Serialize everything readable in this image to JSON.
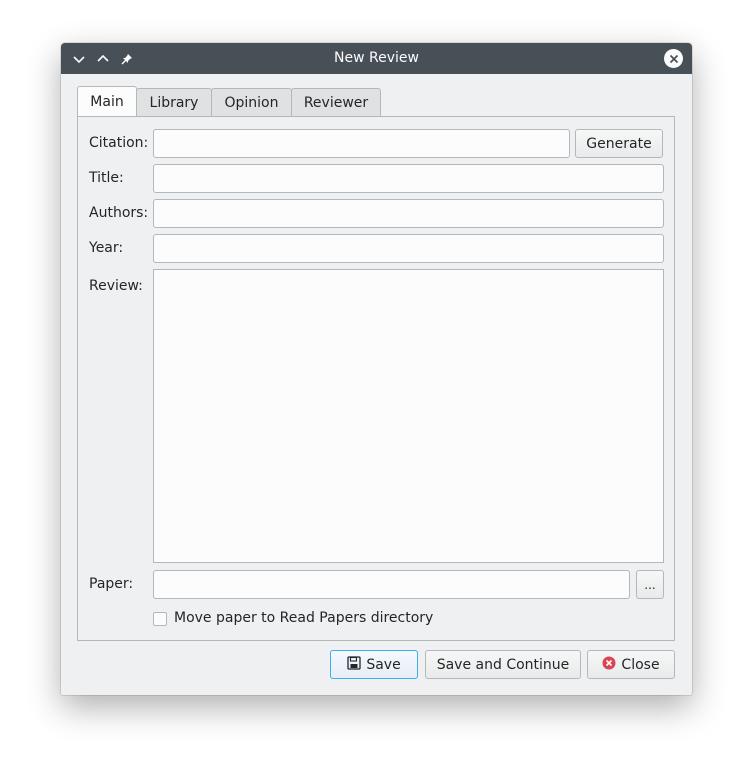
{
  "window": {
    "title": "New Review",
    "icons": {
      "minimize": "chevron-down-icon",
      "maximize": "chevron-up-icon",
      "pin": "pin-icon",
      "close": "close-icon"
    }
  },
  "tabs": [
    {
      "label": "Main",
      "active": true
    },
    {
      "label": "Library",
      "active": false
    },
    {
      "label": "Opinion",
      "active": false
    },
    {
      "label": "Reviewer",
      "active": false
    }
  ],
  "form": {
    "citation_label": "Citation:",
    "citation_value": "",
    "generate_label": "Generate",
    "title_label": "Title:",
    "title_value": "",
    "authors_label": "Authors:",
    "authors_value": "",
    "year_label": "Year:",
    "year_value": "",
    "review_label": "Review:",
    "review_value": "",
    "paper_label": "Paper:",
    "paper_value": "",
    "browse_label": "...",
    "move_label": "Move paper to Read Papers directory",
    "move_checked": false
  },
  "footer": {
    "save_label": "Save",
    "save_icon": "floppy-disk-icon",
    "save_continue_label": "Save and Continue",
    "close_label": "Close",
    "close_icon": "close-circle-icon"
  },
  "colors": {
    "titlebar": "#475057",
    "window_bg": "#eff0f1",
    "accent": "#3daee9",
    "close_red": "#da4453"
  }
}
